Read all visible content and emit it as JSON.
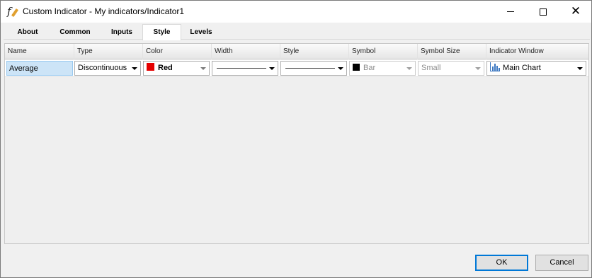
{
  "window": {
    "title": "Custom Indicator - My indicators/Indicator1"
  },
  "tabs": [
    {
      "label": "About"
    },
    {
      "label": "Common"
    },
    {
      "label": "Inputs"
    },
    {
      "label": "Style",
      "active": true
    },
    {
      "label": "Levels"
    }
  ],
  "grid": {
    "columns": [
      "Name",
      "Type",
      "Color",
      "Width",
      "Style",
      "Symbol",
      "Symbol Size",
      "Indicator Window"
    ],
    "rows": [
      {
        "name": "Average",
        "type": "Discontinuous",
        "color": {
          "label": "Red",
          "hex": "#e50000"
        },
        "width": "thin-line",
        "style": "solid-line",
        "symbol": {
          "label": "Bar",
          "swatch_hex": "#000000"
        },
        "symbol_size": "Small",
        "indicator_window": "Main Chart"
      }
    ]
  },
  "buttons": {
    "ok": "OK",
    "cancel": "Cancel"
  },
  "colors": {
    "accent": "#0078d7",
    "selection": "#cce4f7"
  }
}
